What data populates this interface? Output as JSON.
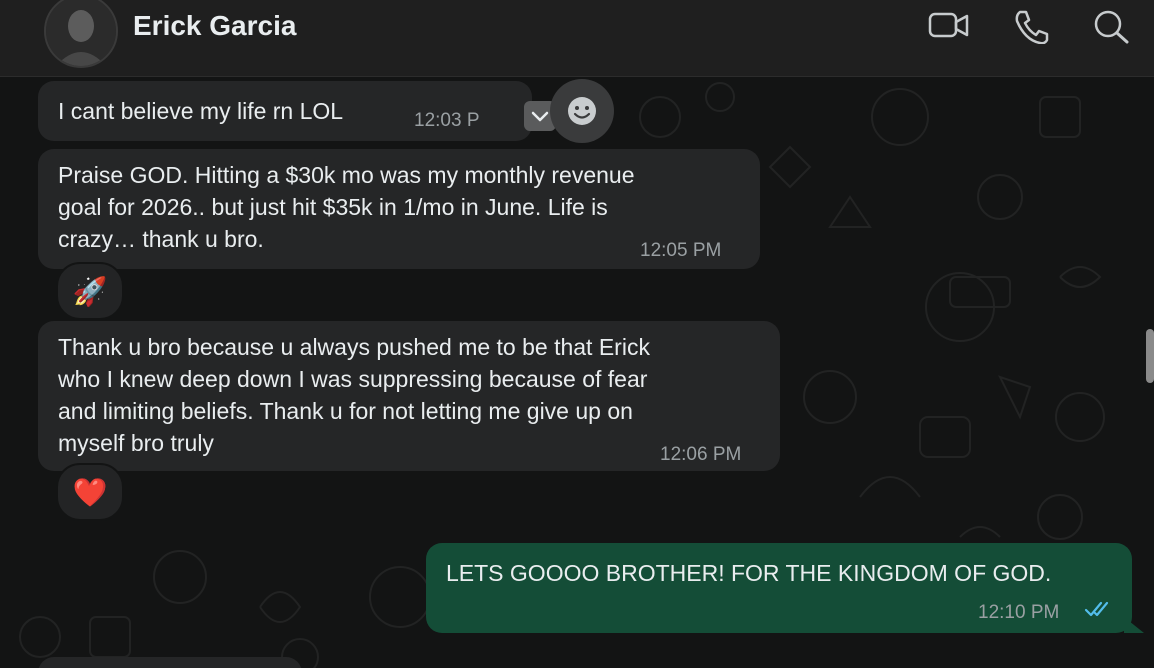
{
  "header": {
    "contact_name": "Erick Garcia",
    "icons": [
      "video-call-icon",
      "voice-call-icon",
      "search-icon"
    ]
  },
  "messages": [
    {
      "direction": "in",
      "text": "I cant believe my life rn LOL",
      "time": "12:03 PM",
      "time_visible": "12:03 P"
    },
    {
      "direction": "in",
      "text": "Praise GOD. Hitting a $30k mo was my monthly revenue\ngoal for 2026.. but just hit $35k in 1/mo in June. Life is\ncrazy… thank u bro.",
      "time": "12:05 PM",
      "reaction": "🚀"
    },
    {
      "direction": "in",
      "text": "Thank u bro because u always pushed me to be that Erick\nwho I knew deep down I was suppressing because of fear\nand limiting beliefs. Thank u for not letting me give up on\nmyself bro truly",
      "time": "12:06 PM",
      "reaction": "❤️"
    },
    {
      "direction": "out",
      "text": "LETS GOOOO BROTHER! FOR THE KINGDOM OF GOD.",
      "time": "12:10 PM",
      "status": "read"
    }
  ],
  "colors": {
    "incoming_bubble": "#252627",
    "outgoing_bubble": "#144d37",
    "read_ticks": "#53bdeb",
    "chat_background": "#131414"
  }
}
